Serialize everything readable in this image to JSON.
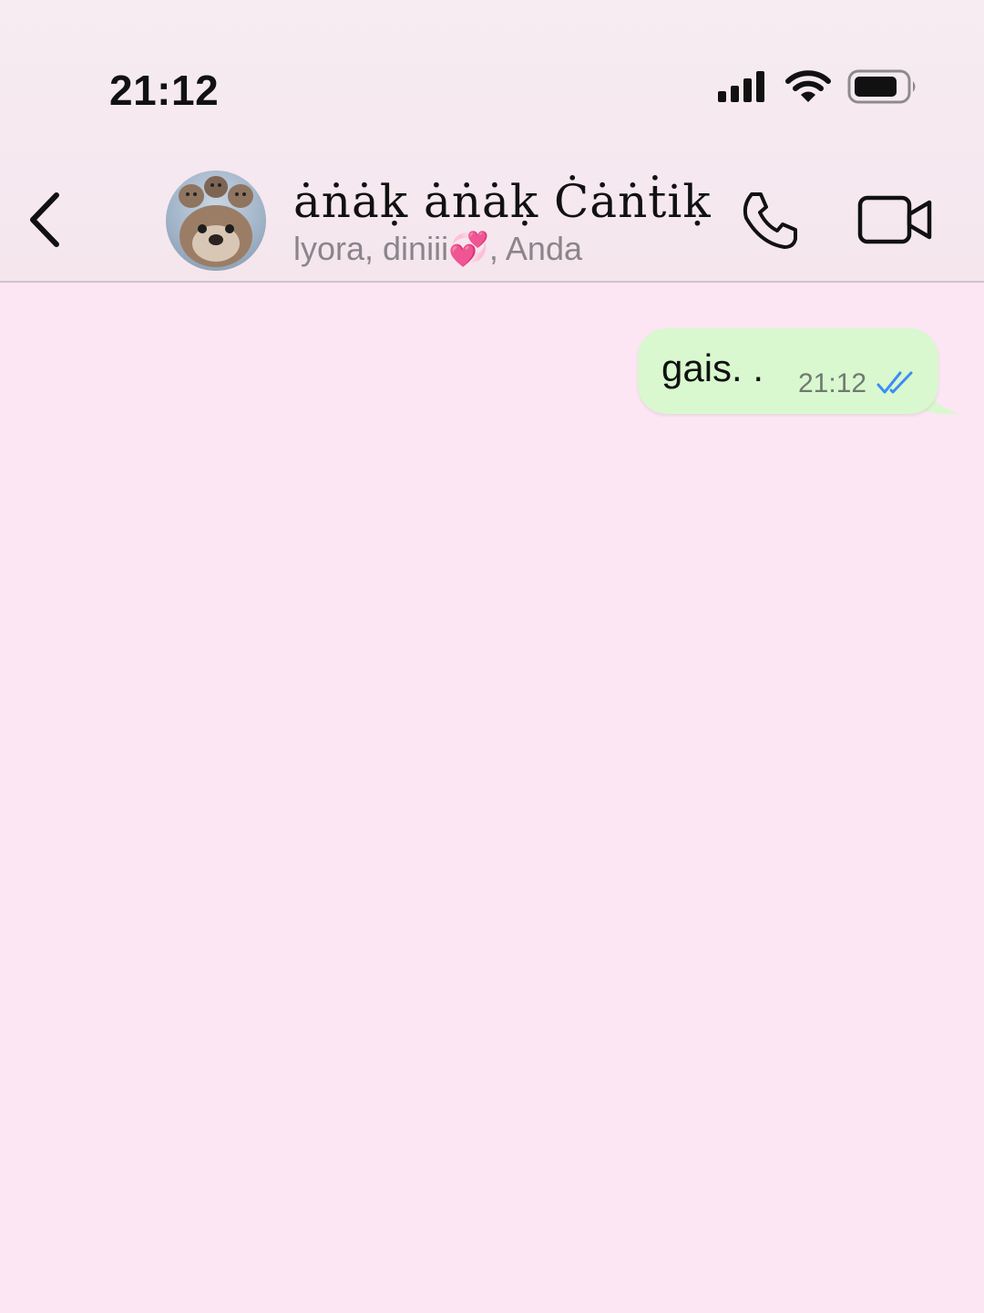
{
  "status_bar": {
    "time": "21:12",
    "icons": [
      "cellular-signal-icon",
      "wifi-icon",
      "battery-icon"
    ]
  },
  "header": {
    "back_icon": "chevron-left-icon",
    "avatar": "group-avatar",
    "title": "ȧṅȧḳ ȧṅȧḳ Ċȧṅṫiḳ",
    "subtitle": "lyora, diniii💞, Anda",
    "call_icon": "phone-icon",
    "video_icon": "video-camera-icon"
  },
  "messages": [
    {
      "direction": "outgoing",
      "text": "gais. .",
      "time": "21:12",
      "status_icon": "double-check-read-icon"
    }
  ],
  "colors": {
    "chat_background": "#fce6f3",
    "header_background": "#f5e6ee",
    "outgoing_bubble": "#d9f8cf",
    "read_tick": "#3b8df5",
    "subtitle_text": "#8a858a"
  }
}
